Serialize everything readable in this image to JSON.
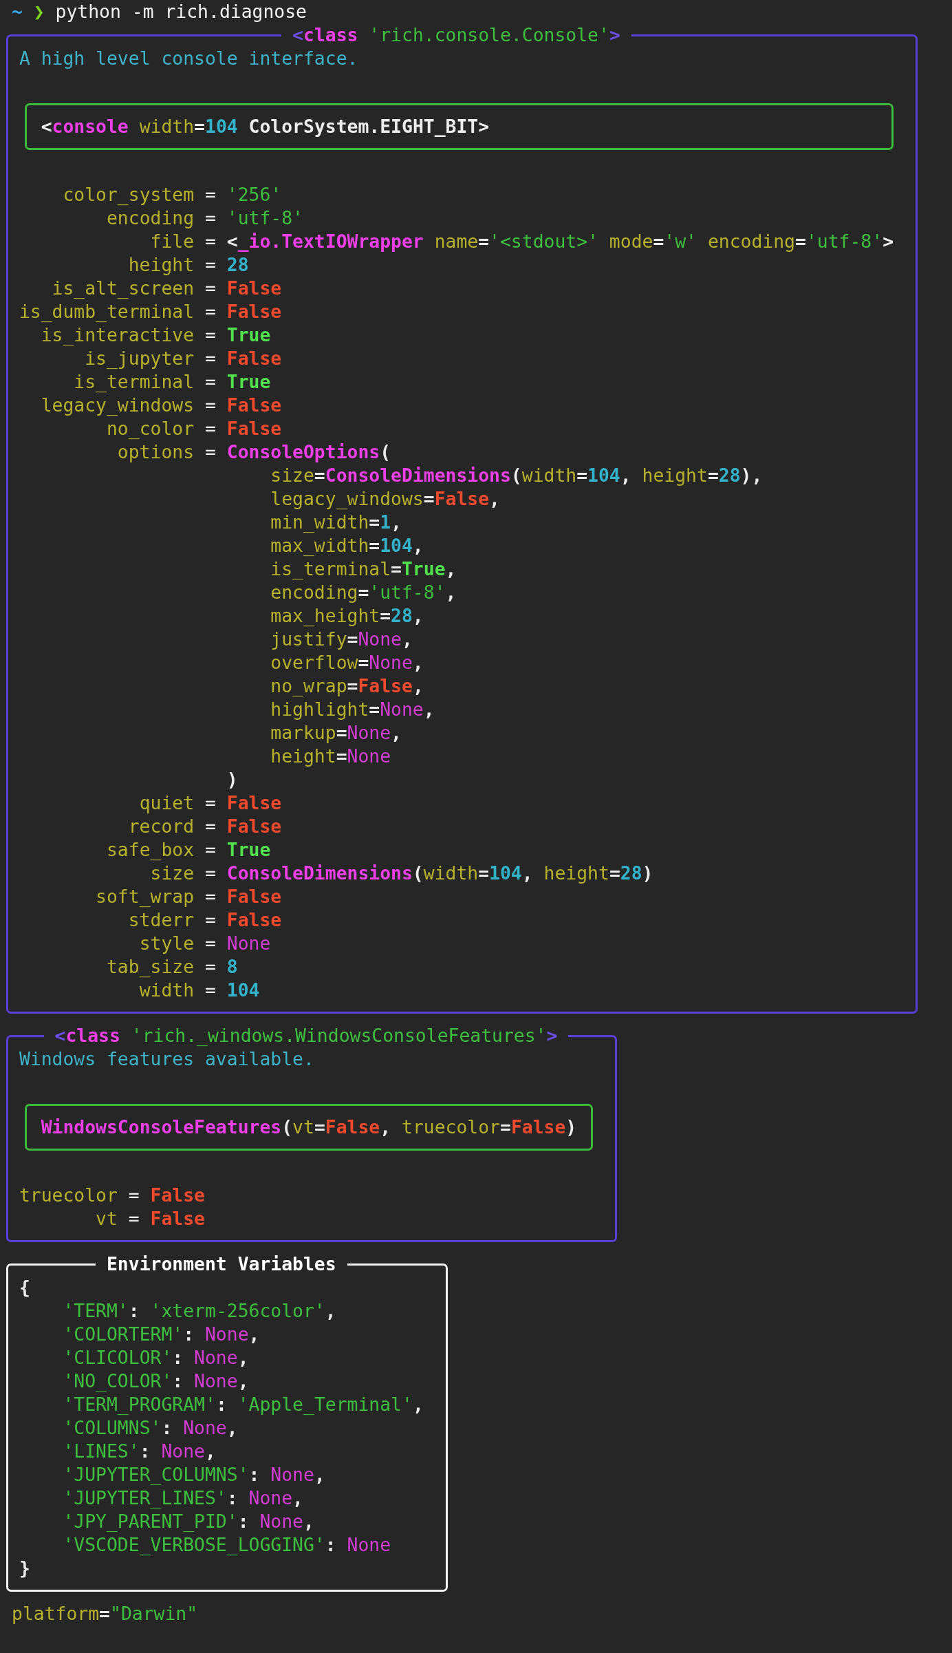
{
  "prompt": {
    "symbol": "~",
    "arrow": "❯",
    "command": "python -m rich.diagnose"
  },
  "panels": [
    {
      "kind": "inspect",
      "color": "#5a3fd8",
      "title": [
        {
          "text": "<",
          "kind": "angle"
        },
        {
          "text": "class",
          "kind": "cls"
        },
        {
          "text": " 'rich.console.Console'",
          "kind": "str"
        },
        {
          "text": ">",
          "kind": "angle"
        }
      ],
      "description": "A high level console interface.",
      "repr": [
        {
          "text": "<",
          "kind": "plain"
        },
        {
          "text": "console",
          "kind": "cls"
        },
        {
          "text": " width",
          "kind": "key"
        },
        {
          "text": "=",
          "kind": "plain"
        },
        {
          "text": "104",
          "kind": "num"
        },
        {
          "text": " ColorSystem.EIGHT_BIT>",
          "kind": "plain"
        }
      ],
      "attributes": [
        {
          "key": "color_system",
          "separator": "=",
          "value": [
            {
              "text": "'256'",
              "kind": "str"
            }
          ]
        },
        {
          "key": "encoding",
          "separator": "=",
          "value": [
            {
              "text": "'utf-8'",
              "kind": "str"
            }
          ]
        },
        {
          "key": "file",
          "separator": "=",
          "value": [
            {
              "text": "<",
              "kind": "plain"
            },
            {
              "text": "_io.TextIOWrapper",
              "kind": "cls"
            },
            {
              "text": " name",
              "kind": "key"
            },
            {
              "text": "=",
              "kind": "plain"
            },
            {
              "text": "'<stdout>'",
              "kind": "str"
            },
            {
              "text": " mode",
              "kind": "key"
            },
            {
              "text": "=",
              "kind": "plain"
            },
            {
              "text": "'w'",
              "kind": "str"
            },
            {
              "text": " encoding",
              "kind": "key"
            },
            {
              "text": "=",
              "kind": "plain"
            },
            {
              "text": "'utf-8'",
              "kind": "str"
            },
            {
              "text": ">",
              "kind": "plain"
            }
          ]
        },
        {
          "key": "height",
          "separator": "=",
          "value": [
            {
              "text": "28",
              "kind": "num"
            }
          ]
        },
        {
          "key": "is_alt_screen",
          "separator": "=",
          "value": [
            {
              "text": "False",
              "kind": "false"
            }
          ]
        },
        {
          "key": "is_dumb_terminal",
          "separator": "=",
          "value": [
            {
              "text": "False",
              "kind": "false"
            }
          ]
        },
        {
          "key": "is_interactive",
          "separator": "=",
          "value": [
            {
              "text": "True",
              "kind": "true"
            }
          ]
        },
        {
          "key": "is_jupyter",
          "separator": "=",
          "value": [
            {
              "text": "False",
              "kind": "false"
            }
          ]
        },
        {
          "key": "is_terminal",
          "separator": "=",
          "value": [
            {
              "text": "True",
              "kind": "true"
            }
          ]
        },
        {
          "key": "legacy_windows",
          "separator": "=",
          "value": [
            {
              "text": "False",
              "kind": "false"
            }
          ]
        },
        {
          "key": "no_color",
          "separator": "=",
          "value": [
            {
              "text": "False",
              "kind": "false"
            }
          ]
        },
        {
          "key": "options",
          "separator": "=",
          "value": [
            {
              "text": "ConsoleOptions",
              "kind": "cls"
            },
            {
              "text": "(",
              "kind": "plain"
            }
          ],
          "children": [
            [
              {
                "text": "size",
                "kind": "key"
              },
              {
                "text": "=",
                "kind": "plain"
              },
              {
                "text": "ConsoleDimensions",
                "kind": "cls"
              },
              {
                "text": "(",
                "kind": "plain"
              },
              {
                "text": "width",
                "kind": "key"
              },
              {
                "text": "=",
                "kind": "plain"
              },
              {
                "text": "104",
                "kind": "num"
              },
              {
                "text": ", ",
                "kind": "plain"
              },
              {
                "text": "height",
                "kind": "key"
              },
              {
                "text": "=",
                "kind": "plain"
              },
              {
                "text": "28",
                "kind": "num"
              },
              {
                "text": "),",
                "kind": "plain"
              }
            ],
            [
              {
                "text": "legacy_windows",
                "kind": "key"
              },
              {
                "text": "=",
                "kind": "plain"
              },
              {
                "text": "False",
                "kind": "false"
              },
              {
                "text": ",",
                "kind": "plain"
              }
            ],
            [
              {
                "text": "min_width",
                "kind": "key"
              },
              {
                "text": "=",
                "kind": "plain"
              },
              {
                "text": "1",
                "kind": "num"
              },
              {
                "text": ",",
                "kind": "plain"
              }
            ],
            [
              {
                "text": "max_width",
                "kind": "key"
              },
              {
                "text": "=",
                "kind": "plain"
              },
              {
                "text": "104",
                "kind": "num"
              },
              {
                "text": ",",
                "kind": "plain"
              }
            ],
            [
              {
                "text": "is_terminal",
                "kind": "key"
              },
              {
                "text": "=",
                "kind": "plain"
              },
              {
                "text": "True",
                "kind": "true"
              },
              {
                "text": ",",
                "kind": "plain"
              }
            ],
            [
              {
                "text": "encoding",
                "kind": "key"
              },
              {
                "text": "=",
                "kind": "plain"
              },
              {
                "text": "'utf-8'",
                "kind": "str"
              },
              {
                "text": ",",
                "kind": "plain"
              }
            ],
            [
              {
                "text": "max_height",
                "kind": "key"
              },
              {
                "text": "=",
                "kind": "plain"
              },
              {
                "text": "28",
                "kind": "num"
              },
              {
                "text": ",",
                "kind": "plain"
              }
            ],
            [
              {
                "text": "justify",
                "kind": "key"
              },
              {
                "text": "=",
                "kind": "plain"
              },
              {
                "text": "None",
                "kind": "none"
              },
              {
                "text": ",",
                "kind": "plain"
              }
            ],
            [
              {
                "text": "overflow",
                "kind": "key"
              },
              {
                "text": "=",
                "kind": "plain"
              },
              {
                "text": "None",
                "kind": "none"
              },
              {
                "text": ",",
                "kind": "plain"
              }
            ],
            [
              {
                "text": "no_wrap",
                "kind": "key"
              },
              {
                "text": "=",
                "kind": "plain"
              },
              {
                "text": "False",
                "kind": "false"
              },
              {
                "text": ",",
                "kind": "plain"
              }
            ],
            [
              {
                "text": "highlight",
                "kind": "key"
              },
              {
                "text": "=",
                "kind": "plain"
              },
              {
                "text": "None",
                "kind": "none"
              },
              {
                "text": ",",
                "kind": "plain"
              }
            ],
            [
              {
                "text": "markup",
                "kind": "key"
              },
              {
                "text": "=",
                "kind": "plain"
              },
              {
                "text": "None",
                "kind": "none"
              },
              {
                "text": ",",
                "kind": "plain"
              }
            ],
            [
              {
                "text": "height",
                "kind": "key"
              },
              {
                "text": "=",
                "kind": "plain"
              },
              {
                "text": "None",
                "kind": "none"
              }
            ]
          ],
          "close": ")"
        },
        {
          "key": "quiet",
          "separator": "=",
          "value": [
            {
              "text": "False",
              "kind": "false"
            }
          ]
        },
        {
          "key": "record",
          "separator": "=",
          "value": [
            {
              "text": "False",
              "kind": "false"
            }
          ]
        },
        {
          "key": "safe_box",
          "separator": "=",
          "value": [
            {
              "text": "True",
              "kind": "true"
            }
          ]
        },
        {
          "key": "size",
          "separator": "=",
          "value": [
            {
              "text": "ConsoleDimensions",
              "kind": "cls"
            },
            {
              "text": "(",
              "kind": "plain"
            },
            {
              "text": "width",
              "kind": "key"
            },
            {
              "text": "=",
              "kind": "plain"
            },
            {
              "text": "104",
              "kind": "num"
            },
            {
              "text": ", ",
              "kind": "plain"
            },
            {
              "text": "height",
              "kind": "key"
            },
            {
              "text": "=",
              "kind": "plain"
            },
            {
              "text": "28",
              "kind": "num"
            },
            {
              "text": ")",
              "kind": "plain"
            }
          ]
        },
        {
          "key": "soft_wrap",
          "separator": "=",
          "value": [
            {
              "text": "False",
              "kind": "false"
            }
          ]
        },
        {
          "key": "stderr",
          "separator": "=",
          "value": [
            {
              "text": "False",
              "kind": "false"
            }
          ]
        },
        {
          "key": "style",
          "separator": "=",
          "value": [
            {
              "text": "None",
              "kind": "none"
            }
          ]
        },
        {
          "key": "tab_size",
          "separator": "=",
          "value": [
            {
              "text": "8",
              "kind": "num"
            }
          ]
        },
        {
          "key": "width",
          "separator": "=",
          "value": [
            {
              "text": "104",
              "kind": "num"
            }
          ]
        }
      ]
    },
    {
      "kind": "inspect",
      "color": "#5a3fd8",
      "title": [
        {
          "text": "<",
          "kind": "angle"
        },
        {
          "text": "class",
          "kind": "cls"
        },
        {
          "text": " 'rich._windows.WindowsConsoleFeatures'",
          "kind": "str"
        },
        {
          "text": ">",
          "kind": "angle"
        }
      ],
      "description": "Windows features available.",
      "repr": [
        {
          "text": "WindowsConsoleFeatures",
          "kind": "cls"
        },
        {
          "text": "(",
          "kind": "plain"
        },
        {
          "text": "vt",
          "kind": "key"
        },
        {
          "text": "=",
          "kind": "plain"
        },
        {
          "text": "False",
          "kind": "false"
        },
        {
          "text": ", ",
          "kind": "plain"
        },
        {
          "text": "truecolor",
          "kind": "key"
        },
        {
          "text": "=",
          "kind": "plain"
        },
        {
          "text": "False",
          "kind": "false"
        },
        {
          "text": ")",
          "kind": "plain"
        }
      ],
      "attributes": [
        {
          "key": "truecolor",
          "separator": "=",
          "value": [
            {
              "text": "False",
              "kind": "false"
            }
          ]
        },
        {
          "key": "vt",
          "separator": "=",
          "value": [
            {
              "text": "False",
              "kind": "false"
            }
          ]
        }
      ]
    },
    {
      "kind": "mapping",
      "color": "#f2f2f2",
      "title": [
        {
          "text": "Environment Variables",
          "kind": "heading"
        }
      ],
      "open": "{",
      "entries": [
        [
          {
            "text": "'TERM'",
            "kind": "str"
          },
          {
            "text": ": ",
            "kind": "plain"
          },
          {
            "text": "'xterm-256color'",
            "kind": "str"
          },
          {
            "text": ",",
            "kind": "plain"
          }
        ],
        [
          {
            "text": "'COLORTERM'",
            "kind": "str"
          },
          {
            "text": ": ",
            "kind": "plain"
          },
          {
            "text": "None",
            "kind": "none"
          },
          {
            "text": ",",
            "kind": "plain"
          }
        ],
        [
          {
            "text": "'CLICOLOR'",
            "kind": "str"
          },
          {
            "text": ": ",
            "kind": "plain"
          },
          {
            "text": "None",
            "kind": "none"
          },
          {
            "text": ",",
            "kind": "plain"
          }
        ],
        [
          {
            "text": "'NO_COLOR'",
            "kind": "str"
          },
          {
            "text": ": ",
            "kind": "plain"
          },
          {
            "text": "None",
            "kind": "none"
          },
          {
            "text": ",",
            "kind": "plain"
          }
        ],
        [
          {
            "text": "'TERM_PROGRAM'",
            "kind": "str"
          },
          {
            "text": ": ",
            "kind": "plain"
          },
          {
            "text": "'Apple_Terminal'",
            "kind": "str"
          },
          {
            "text": ",",
            "kind": "plain"
          }
        ],
        [
          {
            "text": "'COLUMNS'",
            "kind": "str"
          },
          {
            "text": ": ",
            "kind": "plain"
          },
          {
            "text": "None",
            "kind": "none"
          },
          {
            "text": ",",
            "kind": "plain"
          }
        ],
        [
          {
            "text": "'LINES'",
            "kind": "str"
          },
          {
            "text": ": ",
            "kind": "plain"
          },
          {
            "text": "None",
            "kind": "none"
          },
          {
            "text": ",",
            "kind": "plain"
          }
        ],
        [
          {
            "text": "'JUPYTER_COLUMNS'",
            "kind": "str"
          },
          {
            "text": ": ",
            "kind": "plain"
          },
          {
            "text": "None",
            "kind": "none"
          },
          {
            "text": ",",
            "kind": "plain"
          }
        ],
        [
          {
            "text": "'JUPYTER_LINES'",
            "kind": "str"
          },
          {
            "text": ": ",
            "kind": "plain"
          },
          {
            "text": "None",
            "kind": "none"
          },
          {
            "text": ",",
            "kind": "plain"
          }
        ],
        [
          {
            "text": "'JPY_PARENT_PID'",
            "kind": "str"
          },
          {
            "text": ": ",
            "kind": "plain"
          },
          {
            "text": "None",
            "kind": "none"
          },
          {
            "text": ",",
            "kind": "plain"
          }
        ],
        [
          {
            "text": "'VSCODE_VERBOSE_LOGGING'",
            "kind": "str"
          },
          {
            "text": ": ",
            "kind": "plain"
          },
          {
            "text": "None",
            "kind": "none"
          }
        ]
      ],
      "close": "}"
    }
  ],
  "platform": [
    {
      "text": "platform",
      "kind": "key"
    },
    {
      "text": "=",
      "kind": "plain"
    },
    {
      "text": "\"Darwin\"",
      "kind": "str"
    }
  ]
}
